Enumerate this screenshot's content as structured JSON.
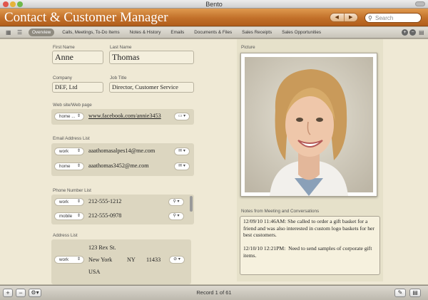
{
  "window": {
    "title": "Bento"
  },
  "app": {
    "title": "Contact & Customer Manager",
    "nav_back": "◀",
    "nav_forward": "▶"
  },
  "search": {
    "placeholder": "Search"
  },
  "tabs": [
    "Overview",
    "Calls, Meetings, To-Do Items",
    "Notes & History",
    "Emails",
    "Documents & Files",
    "Sales Receipts",
    "Sales Opportunities"
  ],
  "form": {
    "first_name": {
      "label": "First Name",
      "value": "Anne"
    },
    "last_name": {
      "label": "Last Name",
      "value": "Thomas"
    },
    "company": {
      "label": "Company",
      "value": "DEF, Ltd"
    },
    "job_title": {
      "label": "Job Title",
      "value": "Director, Customer Service"
    },
    "website": {
      "label": "Web site/Web page",
      "type": "home ...",
      "value": "www.facebook.com/annie3453"
    },
    "email": {
      "label": "Email Address List",
      "items": [
        {
          "type": "work",
          "value": "aaathomasalpes14@me.com"
        },
        {
          "type": "home",
          "value": "aaathomas3452@me.com"
        }
      ]
    },
    "phone": {
      "label": "Phone Number List",
      "items": [
        {
          "type": "work",
          "value": "212-555-1212"
        },
        {
          "type": "mobile",
          "value": "212-555-0978"
        }
      ]
    },
    "address": {
      "label": "Address List",
      "type": "work",
      "street": "123 Rex St.",
      "city": "New York",
      "state": "NY",
      "zip": "11433",
      "country": "USA"
    }
  },
  "picture": {
    "label": "Picture"
  },
  "notes": {
    "label": "Notes from Meeting and Conversations",
    "text": "12/09/10 11:46AM: She called to order a gift basket for a friend and was also interested in custom logo baskets for her best customers.\n\n12/10/10 12:21PM:  Need to send samples of corporate gift items."
  },
  "status": {
    "record_info": "Record 1 of 61"
  },
  "colors": {
    "header_orange": "#c2702a",
    "content_bg": "#efe9d5"
  }
}
